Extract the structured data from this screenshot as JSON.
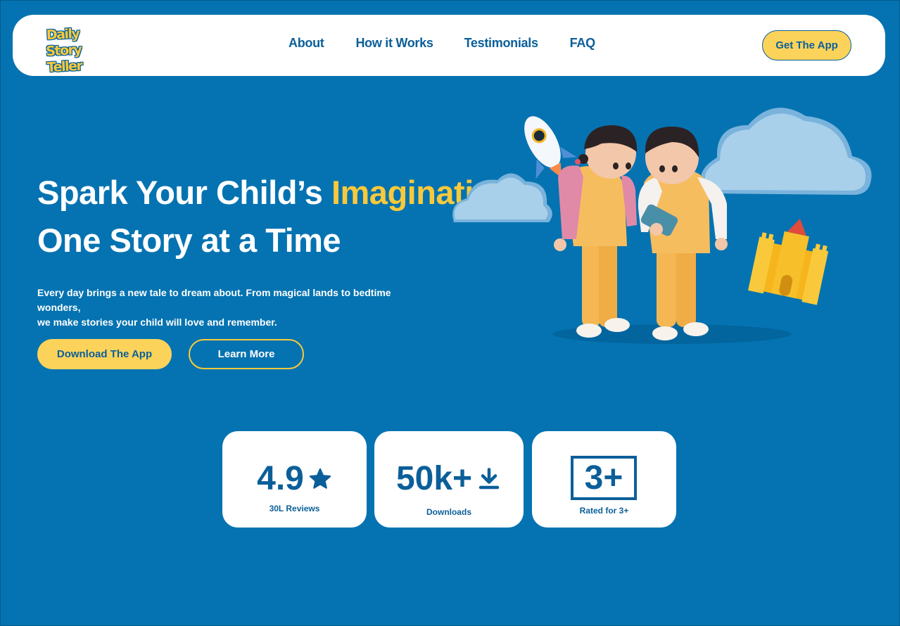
{
  "nav": {
    "logo_line1": "Daily",
    "logo_line2": "Story Teller",
    "links": [
      "About",
      "How it Works",
      "Testimonials",
      "FAQ"
    ],
    "cta": "Get The App"
  },
  "hero": {
    "title_part1": "Spark Your Child’s ",
    "title_accent": "Imagination",
    "title_line2": "One Story at a Time",
    "subtitle_line1": "Every day brings a new tale to dream about. From magical lands to bedtime wonders,",
    "subtitle_line2": "we make stories your child will love and remember.",
    "primary_button": "Download The App",
    "secondary_button": "Learn More"
  },
  "stats": [
    {
      "value": "4.9",
      "label": "30L Reviews",
      "icon": "star-icon"
    },
    {
      "value": "50k+",
      "label": "Downloads",
      "icon": "download-icon"
    },
    {
      "value": "3+",
      "label": "Rated for 3+",
      "icon": "age-rating-box"
    }
  ],
  "colors": {
    "background": "#0573b1",
    "accent_yellow": "#f9c93b",
    "button_yellow": "#fcd35a",
    "text_blue": "#0b5f99",
    "white": "#ffffff"
  }
}
